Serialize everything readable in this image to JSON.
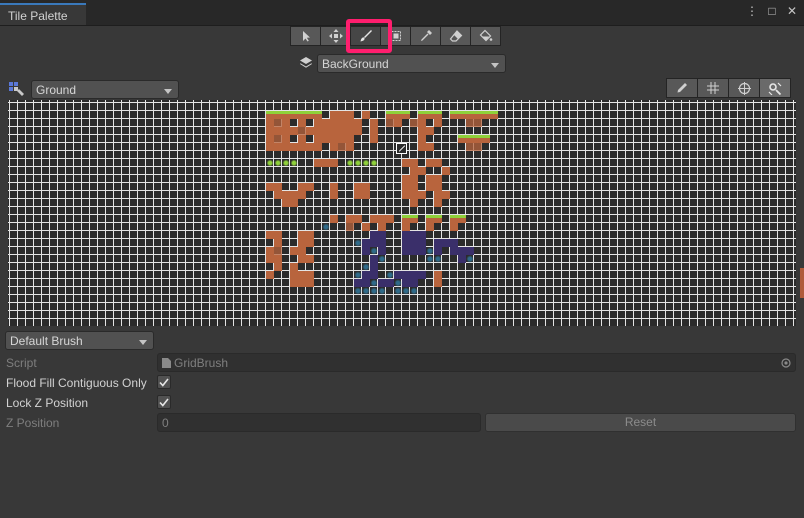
{
  "window": {
    "tab_title": "Tile Palette",
    "tab_buttons": [
      "⋮",
      "□",
      "✕"
    ]
  },
  "toolbar": {
    "tools": [
      {
        "name": "select-tool",
        "icon": "cursor-arrow-icon"
      },
      {
        "name": "move-tool",
        "icon": "move-arrows-icon"
      },
      {
        "name": "paint-tool",
        "icon": "brush-icon",
        "active": true
      },
      {
        "name": "box-fill-tool",
        "icon": "box-select-icon"
      },
      {
        "name": "picker-tool",
        "icon": "eyedropper-icon"
      },
      {
        "name": "erase-tool",
        "icon": "eraser-icon"
      },
      {
        "name": "fill-tool",
        "icon": "paint-bucket-icon"
      }
    ],
    "highlight_color": "#ff1e6e"
  },
  "active_tilemap": {
    "value": "BackGround"
  },
  "palette": {
    "selected": "Ground",
    "right_tools": [
      "edit-palette-icon",
      "grid-toggle-icon",
      "gizmo-icon",
      "settings-icon"
    ]
  },
  "brush": {
    "selected": "Default Brush",
    "script_label": "Script",
    "script_value": "GridBrush",
    "flood_fill_label": "Flood Fill Contiguous Only",
    "flood_fill_checked": true,
    "lock_z_label": "Lock Z Position",
    "lock_z_checked": true,
    "z_position_label": "Z Position",
    "z_position_value": "0",
    "reset_label": "Reset"
  },
  "colors": {
    "panel_bg": "#383838",
    "grid_line": "#e4e4e4",
    "tile_dirt": "#b8643d",
    "tile_grass": "#8fd13a",
    "tile_purple": "#3a2f6a"
  }
}
